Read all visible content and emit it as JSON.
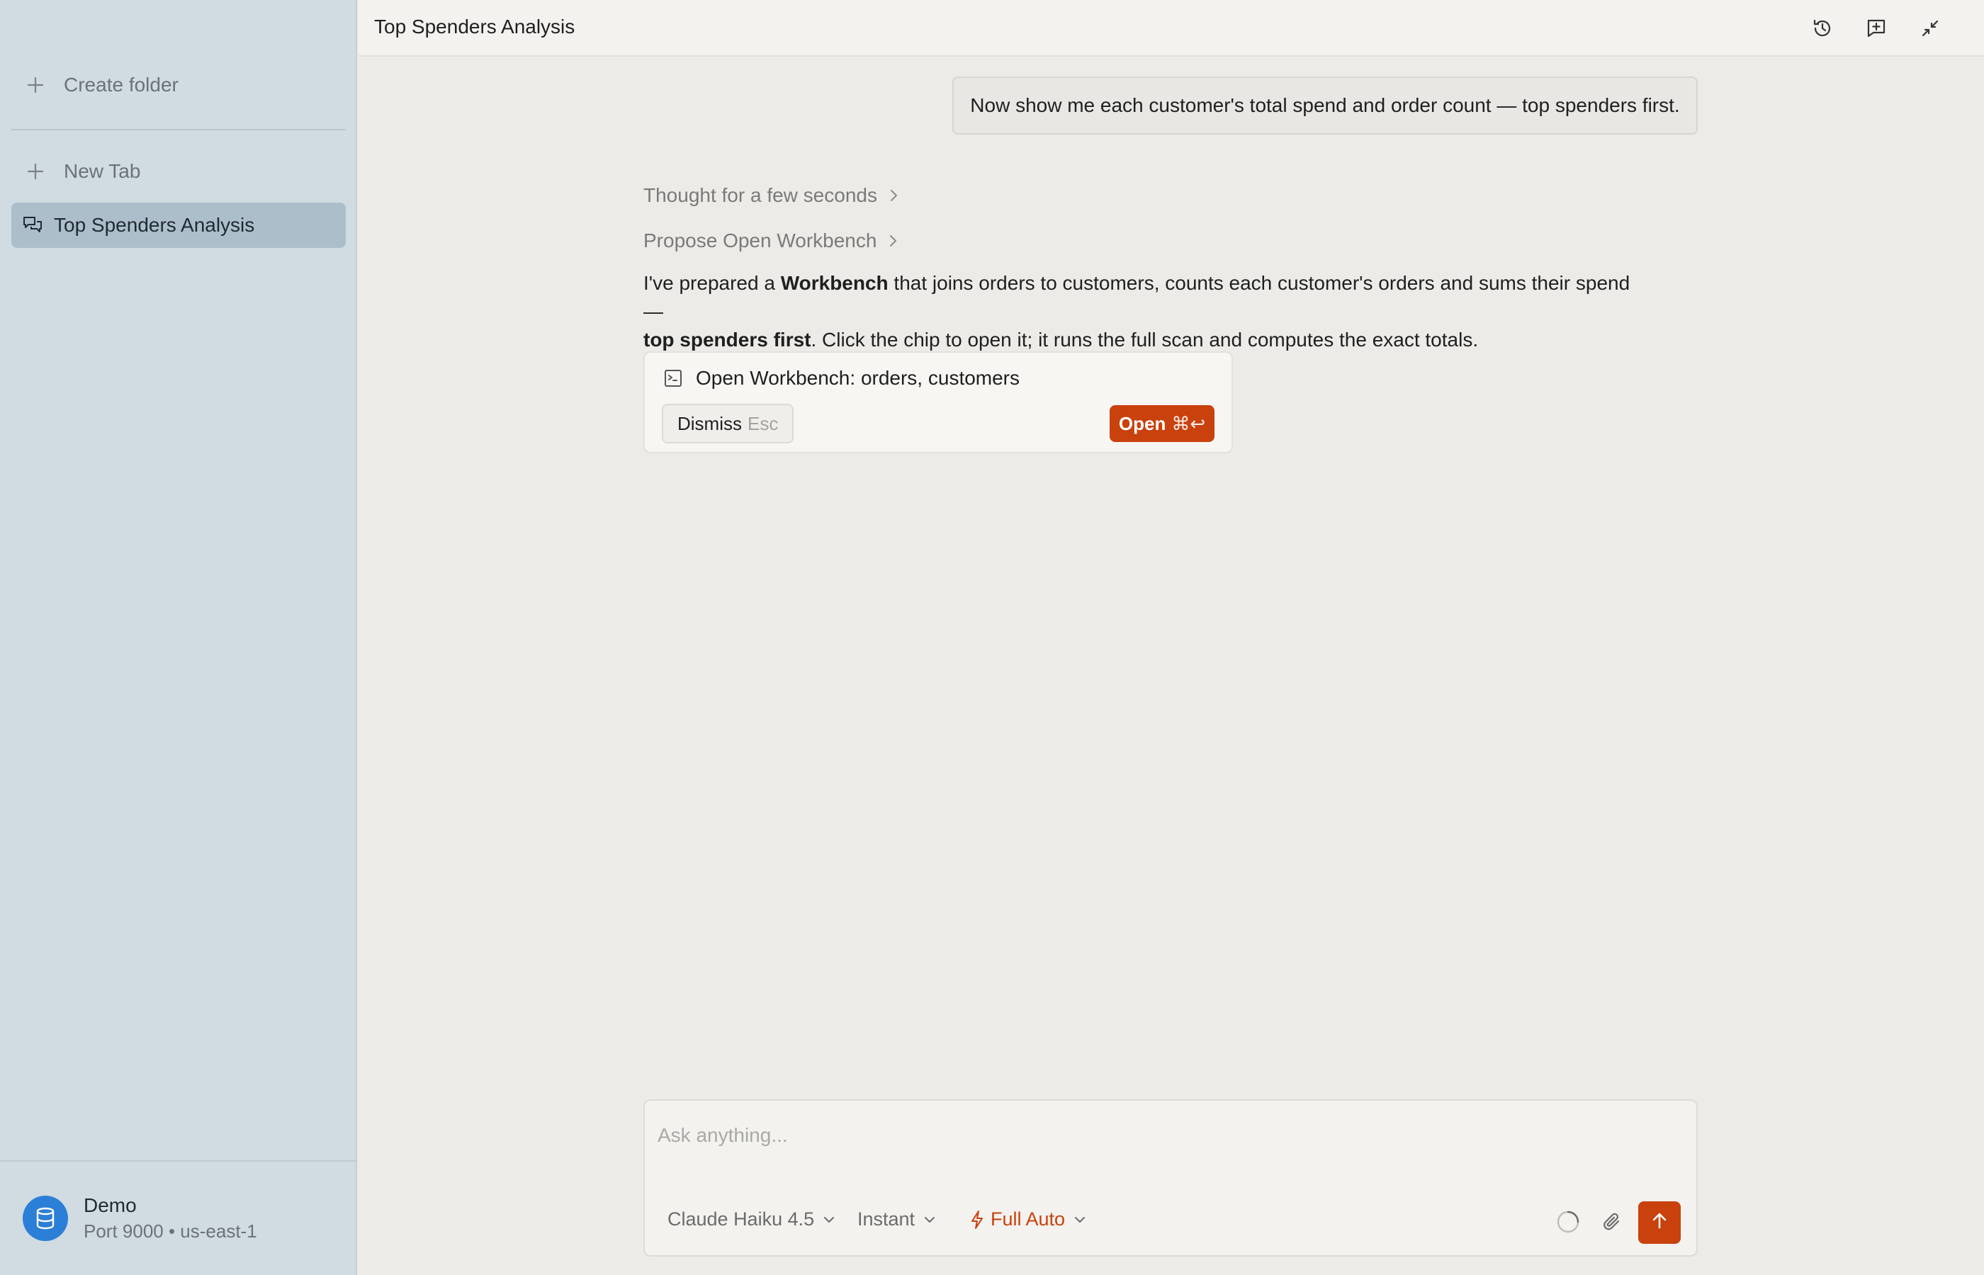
{
  "sidebar": {
    "create_folder_label": "Create folder",
    "new_tab_label": "New Tab",
    "tabs": [
      {
        "label": "Top Spenders Analysis",
        "active": true
      }
    ],
    "account": {
      "name": "Demo",
      "subtitle": "Port 9000 • us-east-1"
    }
  },
  "header": {
    "title": "Top Spenders Analysis",
    "icons": [
      "history-icon",
      "new-chat-icon",
      "collapse-icon"
    ]
  },
  "conversation": {
    "user_message": "Now show me each customer's total spend and order count — top spenders first.",
    "steps": [
      {
        "label": "Thought for a few seconds"
      },
      {
        "label": "Propose Open Workbench"
      }
    ],
    "assistant": {
      "p1": "I've prepared a ",
      "b1": "Workbench",
      "p2": " that joins orders to customers, counts each customer's orders and sums their spend — ",
      "b2": "top spenders first",
      "p3": ". Click the chip to open it; it runs the full scan and computes the exact totals."
    },
    "chip": {
      "title": "Open Workbench: orders, customers",
      "dismiss_label": "Dismiss",
      "dismiss_key": "Esc",
      "open_label": "Open",
      "open_key": "⌘↩"
    }
  },
  "composer": {
    "placeholder": "Ask anything...",
    "model": "Claude Haiku 4.5",
    "speed": "Instant",
    "mode": "Full Auto"
  },
  "colors": {
    "accent": "#c9410c",
    "sidebar_bg": "#d0dbe2",
    "active_tab_bg": "#adbecb",
    "avatar_bg": "#2b7fd6",
    "main_bg": "#ecebe7"
  }
}
